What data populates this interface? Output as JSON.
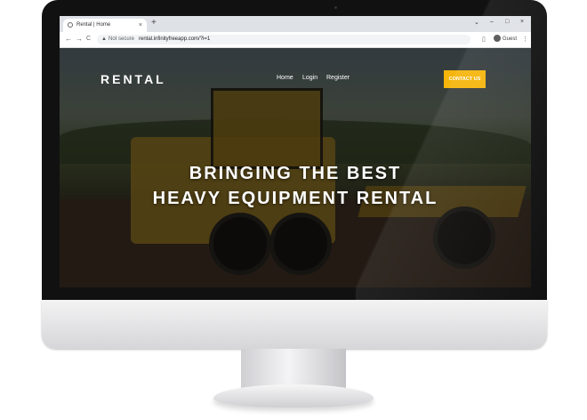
{
  "browser": {
    "tab_title": "Rental | Home",
    "tab_close": "×",
    "new_tab": "+",
    "back": "←",
    "forward": "→",
    "reload": "C",
    "not_secure": "Not secure",
    "url": "rental.infinityfreeapp.com/?i=1",
    "profile": "Guest",
    "menu": "⋮",
    "window_controls": {
      "minimize": "–",
      "restore": "□",
      "close": "×",
      "dropdown": "⌄"
    }
  },
  "site": {
    "brand": "RENTAL",
    "nav": [
      "Home",
      "Login",
      "Register"
    ],
    "contact_button": "CONTACT US",
    "hero_line1": "BRINGING THE BEST",
    "hero_line2": "HEAVY EQUIPMENT RENTAL"
  },
  "colors": {
    "accent": "#f5b50b",
    "tabbar": "#dee1e6"
  }
}
